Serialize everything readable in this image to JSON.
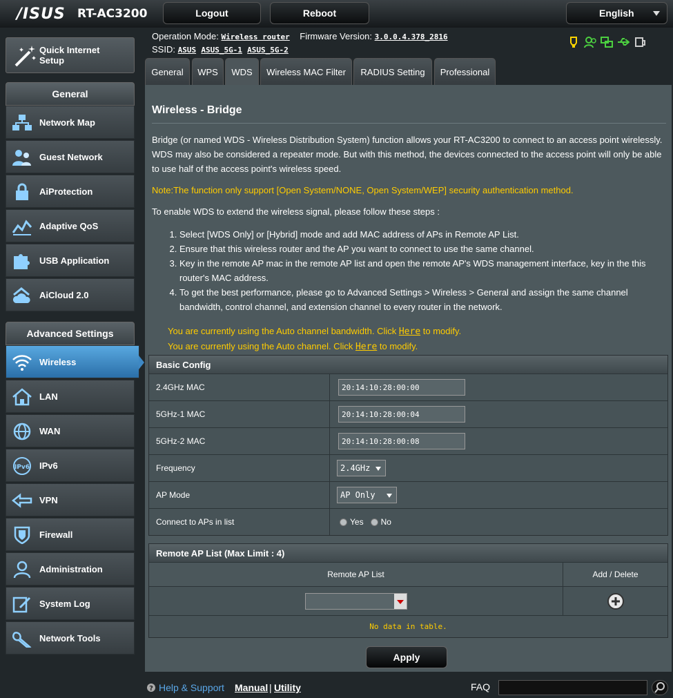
{
  "header": {
    "brand": "/ISUS",
    "model": "RT-AC3200",
    "logout_label": "Logout",
    "reboot_label": "Reboot",
    "language": "English",
    "operation_mode_label": "Operation Mode:",
    "operation_mode_value": "Wireless router",
    "firmware_label": "Firmware Version:",
    "firmware_value": "3.0.0.4.378_2816",
    "ssid_label": "SSID:",
    "ssids": [
      "ASUS",
      "ASUS_5G-1",
      "ASUS_5G-2"
    ]
  },
  "sidebar": {
    "quick_setup": "Quick Internet Setup",
    "general_header": "General",
    "general_items": [
      {
        "label": "Network Map"
      },
      {
        "label": "Guest Network"
      },
      {
        "label": "AiProtection"
      },
      {
        "label": "Adaptive QoS"
      },
      {
        "label": "USB Application"
      },
      {
        "label": "AiCloud 2.0"
      }
    ],
    "advanced_header": "Advanced Settings",
    "advanced_items": [
      {
        "label": "Wireless"
      },
      {
        "label": "LAN"
      },
      {
        "label": "WAN"
      },
      {
        "label": "IPv6"
      },
      {
        "label": "VPN"
      },
      {
        "label": "Firewall"
      },
      {
        "label": "Administration"
      },
      {
        "label": "System Log"
      },
      {
        "label": "Network Tools"
      }
    ]
  },
  "tabs": [
    "General",
    "WPS",
    "WDS",
    "Wireless MAC Filter",
    "RADIUS Setting",
    "Professional"
  ],
  "main": {
    "title": "Wireless - Bridge",
    "intro": "Bridge (or named WDS - Wireless Distribution System) function allows your RT-AC3200 to connect to an access point wirelessly. WDS may also be considered a repeater mode. But with this method, the devices connected to the access point will only be able to use half of the access point's wireless speed.",
    "note": "Note:The function only support [Open System/NONE, Open System/WEP] security authentication method.",
    "steps_intro": "To enable WDS to extend the wireless signal, please follow these steps :",
    "steps": [
      "Select [WDS Only] or [Hybrid] mode and add MAC address of APs in Remote AP List.",
      "Ensure that this wireless router and the AP you want to connect to use the same channel.",
      "Key in the remote AP mac in the remote AP list and open the remote AP's WDS management interface, key in the this router's MAC address.",
      "To get the best performance, please go to Advanced Settings > Wireless > General and assign the same channel bandwidth, control channel, and extension channel to every router in the network."
    ],
    "bw_msg_pre": "You are currently using the Auto channel bandwidth. Click ",
    "ch_msg_pre": "You are currently using the Auto channel. Click ",
    "here": "Here",
    "msg_post": " to modify.",
    "basic_config_title": "Basic Config",
    "mac24_label": "2.4GHz MAC",
    "mac24_value": "20:14:10:28:00:00",
    "mac5g1_label": "5GHz-1 MAC",
    "mac5g1_value": "20:14:10:28:00:04",
    "mac5g2_label": "5GHz-2 MAC",
    "mac5g2_value": "20:14:10:28:00:08",
    "frequency_label": "Frequency",
    "frequency_value": "2.4GHz",
    "ap_mode_label": "AP Mode",
    "ap_mode_value": "AP Only",
    "connect_label": "Connect to APs in list",
    "yes": "Yes",
    "no": "No",
    "remote_title": "Remote AP List (Max Limit : 4)",
    "remote_col": "Remote AP List",
    "add_delete_col": "Add / Delete",
    "empty_msg": "No data in table.",
    "apply_label": "Apply"
  },
  "footer": {
    "help": "Help & Support",
    "manual": "Manual",
    "sep": "|",
    "utility": "Utility",
    "faq": "FAQ"
  },
  "colors": {
    "accent_yellow": "#ffcc00",
    "active_blue": "#3e88c4"
  }
}
